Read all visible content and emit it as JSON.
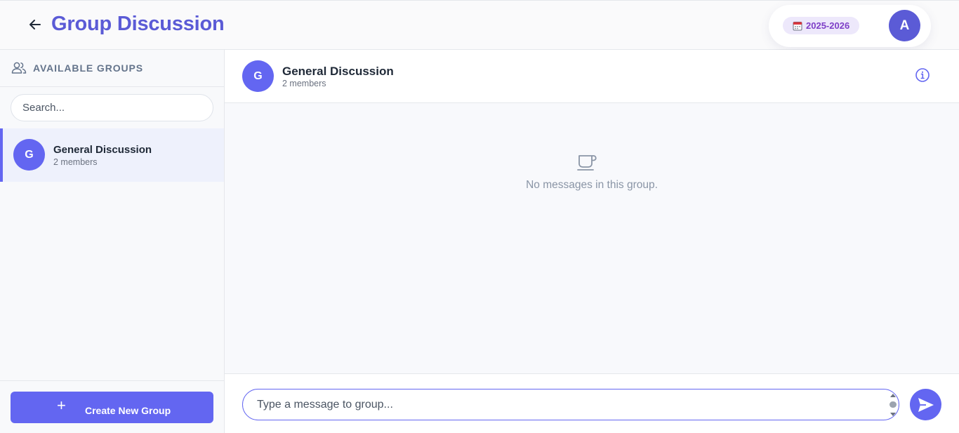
{
  "header": {
    "title": "Group Discussion",
    "year_badge": "2025-2026",
    "user_avatar_initial": "A"
  },
  "sidebar": {
    "title": "AVAILABLE GROUPS",
    "search": {
      "placeholder": "Search...",
      "value": ""
    },
    "groups": [
      {
        "initial": "G",
        "name": "General Discussion",
        "members": "2 members",
        "selected": true
      }
    ],
    "create_button_label": "Create New Group"
  },
  "chat": {
    "group_initial": "G",
    "group_name": "General Discussion",
    "members": "2 members",
    "empty_message": "No messages in this group.",
    "composer_placeholder": "Type a message to group...",
    "composer_value": ""
  },
  "colors": {
    "accent": "#6366f1",
    "title": "#5b5bd6",
    "badge_bg": "#ede8fb",
    "badge_text": "#7e3fc7"
  },
  "icons": {
    "back": "arrow-left-icon",
    "calendar": "calendar-icon",
    "groups": "users-icon",
    "plus": "plus-icon",
    "info": "info-icon",
    "empty": "coffee-cup-icon",
    "send": "send-icon"
  }
}
